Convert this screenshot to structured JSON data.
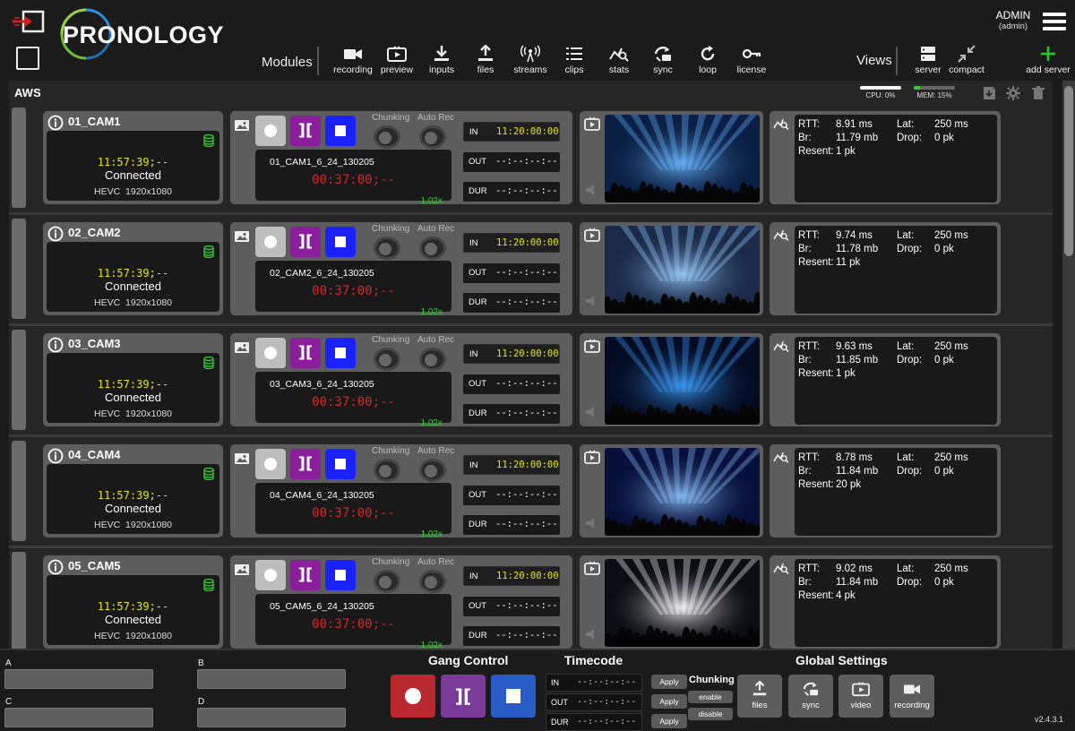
{
  "header": {
    "logo_text": "PRONOLOGY",
    "modules_label": "Modules",
    "views_label": "Views",
    "modules": [
      {
        "id": "recording",
        "label": "recording",
        "icon": "video-camera-icon"
      },
      {
        "id": "preview",
        "label": "preview",
        "icon": "tv-play-icon"
      },
      {
        "id": "inputs",
        "label": "inputs",
        "icon": "download-icon"
      },
      {
        "id": "files",
        "label": "files",
        "icon": "upload-icon"
      },
      {
        "id": "streams",
        "label": "streams",
        "icon": "broadcast-icon"
      },
      {
        "id": "clips",
        "label": "clips",
        "icon": "list-icon"
      },
      {
        "id": "stats",
        "label": "stats",
        "icon": "stats-icon"
      },
      {
        "id": "sync",
        "label": "sync",
        "icon": "sync-icon"
      },
      {
        "id": "loop",
        "label": "loop",
        "icon": "loop-icon"
      },
      {
        "id": "license",
        "label": "license",
        "icon": "key-icon"
      }
    ],
    "views": [
      {
        "id": "server",
        "label": "server",
        "icon": "server-icon"
      },
      {
        "id": "compact",
        "label": "compact",
        "icon": "compact-icon"
      },
      {
        "id": "add_server",
        "label": "add server",
        "icon": "plus-icon"
      }
    ],
    "user": {
      "name": "ADMIN",
      "role": "(admin)"
    }
  },
  "server": {
    "name": "AWS",
    "cpu_label": "CPU: 0%",
    "cpu_level": 1.0,
    "mem_label": "MEM: 15%",
    "mem_level": 0.15
  },
  "cameras": [
    {
      "name": "01_CAM1",
      "tc": "11:57:39;--",
      "status": "Connected",
      "codec": "HEVC",
      "resolution": "1920x1080",
      "chunking_label": "Chunking",
      "autorec_label": "Auto Rec",
      "file": "01_CAM1_6_24_130205",
      "rec_time": "00:37:00;--",
      "speed": "1.02x",
      "in_label": "IN",
      "in_value": "11:20:00:00",
      "out_label": "OUT",
      "out_value": "--:--:--:--",
      "dur_label": "DUR",
      "dur_value": "--:--:--:--",
      "rtt_label": "RTT:",
      "rtt": "8.91 ms",
      "br_label": "Br:",
      "br": "11.79 mb",
      "resent_label": "Resent:",
      "resent": "1 pk",
      "lat_label": "Lat:",
      "lat": "250 ms",
      "drop_label": "Drop:",
      "drop": "0 pk"
    },
    {
      "name": "02_CAM2",
      "tc": "11:57:39;--",
      "status": "Connected",
      "codec": "HEVC",
      "resolution": "1920x1080",
      "chunking_label": "Chunking",
      "autorec_label": "Auto Rec",
      "file": "02_CAM2_6_24_130205",
      "rec_time": "00:37:00;--",
      "speed": "1.02x",
      "in_label": "IN",
      "in_value": "11:20:00:00",
      "out_label": "OUT",
      "out_value": "--:--:--:--",
      "dur_label": "DUR",
      "dur_value": "--:--:--:--",
      "rtt_label": "RTT:",
      "rtt": "9.74 ms",
      "br_label": "Br:",
      "br": "11.78 mb",
      "resent_label": "Resent:",
      "resent": "11 pk",
      "lat_label": "Lat:",
      "lat": "250 ms",
      "drop_label": "Drop:",
      "drop": "0 pk"
    },
    {
      "name": "03_CAM3",
      "tc": "11:57:39;--",
      "status": "Connected",
      "codec": "HEVC",
      "resolution": "1920x1080",
      "chunking_label": "Chunking",
      "autorec_label": "Auto Rec",
      "file": "03_CAM3_6_24_130205",
      "rec_time": "00:37:00;--",
      "speed": "1.02x",
      "in_label": "IN",
      "in_value": "11:20:00:00",
      "out_label": "OUT",
      "out_value": "--:--:--:--",
      "dur_label": "DUR",
      "dur_value": "--:--:--:--",
      "rtt_label": "RTT:",
      "rtt": "9.63 ms",
      "br_label": "Br:",
      "br": "11.85 mb",
      "resent_label": "Resent:",
      "resent": "1 pk",
      "lat_label": "Lat:",
      "lat": "250 ms",
      "drop_label": "Drop:",
      "drop": "0 pk"
    },
    {
      "name": "04_CAM4",
      "tc": "11:57:39;--",
      "status": "Connected",
      "codec": "HEVC",
      "resolution": "1920x1080",
      "chunking_label": "Chunking",
      "autorec_label": "Auto Rec",
      "file": "04_CAM4_6_24_130205",
      "rec_time": "00:37:00;--",
      "speed": "1.02x",
      "in_label": "IN",
      "in_value": "11:20:00:00",
      "out_label": "OUT",
      "out_value": "--:--:--:--",
      "dur_label": "DUR",
      "dur_value": "--:--:--:--",
      "rtt_label": "RTT:",
      "rtt": "8.78 ms",
      "br_label": "Br:",
      "br": "11.84 mb",
      "resent_label": "Resent:",
      "resent": "20 pk",
      "lat_label": "Lat:",
      "lat": "250 ms",
      "drop_label": "Drop:",
      "drop": "0 pk"
    },
    {
      "name": "05_CAM5",
      "tc": "11:57:39;--",
      "status": "Connected",
      "codec": "HEVC",
      "resolution": "1920x1080",
      "chunking_label": "Chunking",
      "autorec_label": "Auto Rec",
      "file": "05_CAM5_6_24_130205",
      "rec_time": "00:37:00;--",
      "speed": "1.02x",
      "in_label": "IN",
      "in_value": "11:20:00:00",
      "out_label": "OUT",
      "out_value": "--:--:--:--",
      "dur_label": "DUR",
      "dur_value": "--:--:--:--",
      "rtt_label": "RTT:",
      "rtt": "9.02 ms",
      "br_label": "Br:",
      "br": "11.84 mb",
      "resent_label": "Resent:",
      "resent": "4 pk",
      "lat_label": "Lat:",
      "lat": "250 ms",
      "drop_label": "Drop:",
      "drop": "0 pk"
    }
  ],
  "footer": {
    "fields": [
      {
        "label": "A",
        "value": ""
      },
      {
        "label": "B",
        "value": ""
      },
      {
        "label": "C",
        "value": ""
      },
      {
        "label": "D",
        "value": ""
      }
    ],
    "gang_title": "Gang Control",
    "timecode_title": "Timecode",
    "tc": [
      {
        "label": "IN",
        "value": "--:--:--:--"
      },
      {
        "label": "OUT",
        "value": "--:--:--:--"
      },
      {
        "label": "DUR",
        "value": "--:--:--:--"
      }
    ],
    "apply_label": "Apply",
    "chunking_title": "Chunking",
    "enable_label": "enable",
    "disable_label": "disable",
    "global_title": "Global Settings",
    "global_buttons": [
      {
        "label": "files",
        "icon": "upload-icon"
      },
      {
        "label": "sync",
        "icon": "sync-icon"
      },
      {
        "label": "video",
        "icon": "tv-play-icon"
      },
      {
        "label": "recording",
        "icon": "video-camera-icon"
      }
    ],
    "version": "v2.4.3.1"
  },
  "colors": {
    "record_grey": "#bdbdbd",
    "split_purple": "#8a1e9b",
    "stop_blue": "#1a22ff",
    "gang_record": "#b8282e",
    "gang_split": "#7a3a9a",
    "gang_stop": "#2a5cc8",
    "timecode_yellow": "#e6e600",
    "rec_red": "#d22222",
    "speed_green": "#33cc33",
    "add_green": "#22cc22"
  }
}
